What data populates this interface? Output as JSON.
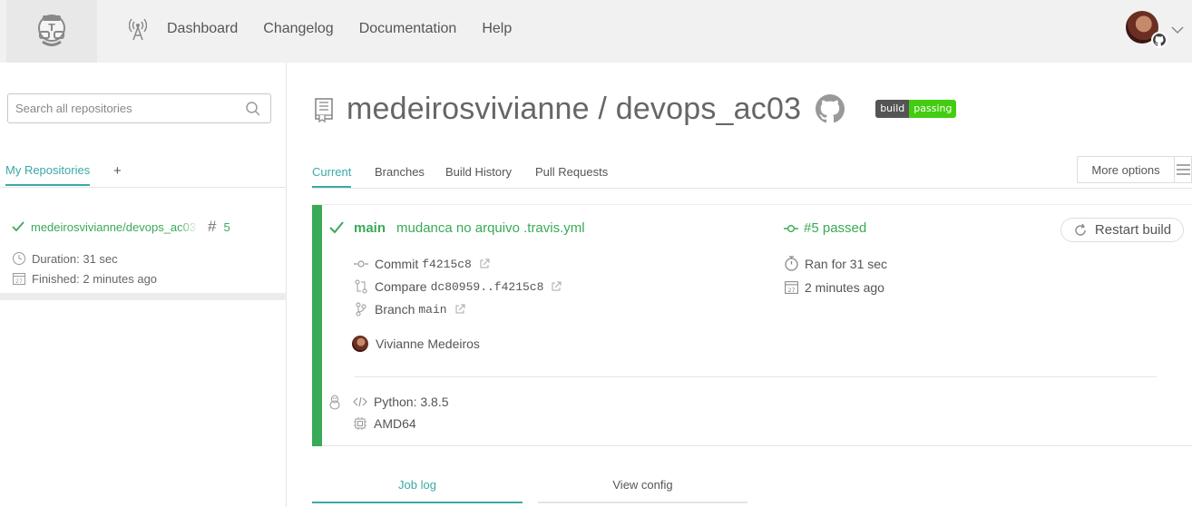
{
  "topnav": {
    "items": [
      "Dashboard",
      "Changelog",
      "Documentation",
      "Help"
    ]
  },
  "sidebar": {
    "search_placeholder": "Search all repositories",
    "tab_label": "My Repositories",
    "add_label": "+",
    "repo": {
      "name": "medeirosvivianne/devops_ac03",
      "hash_symbol": "#",
      "build_number": "5",
      "duration": "Duration: 31 sec",
      "finished": "Finished: 2 minutes ago"
    }
  },
  "repo_header": {
    "title": "medeirosvivianne / devops_ac03",
    "badge_left": "build",
    "badge_right": "passing",
    "badge_colors": {
      "left": "#555555",
      "right": "#44cc11"
    }
  },
  "main_tabs": [
    "Current",
    "Branches",
    "Build History",
    "Pull Requests"
  ],
  "more_options": "More options",
  "build": {
    "branch": "main",
    "message": "mudanca no arquivo .travis.yml",
    "status": "#5 passed",
    "restart_label": "Restart build",
    "commit_label": "Commit",
    "commit_hash": "f4215c8",
    "compare_label": "Compare",
    "compare_range": "dc80959..f4215c8",
    "branch_label": "Branch",
    "branch_value": "main",
    "ran_for": "Ran for 31 sec",
    "finished_ago": "2 minutes ago",
    "author": "Vivianne Medeiros",
    "language": "Python: 3.8.5",
    "arch": "AMD64",
    "status_color": "#39aa56"
  },
  "bottom_tabs": {
    "job_log": "Job log",
    "view_config": "View config"
  },
  "accent_color": "#3ba9a7"
}
